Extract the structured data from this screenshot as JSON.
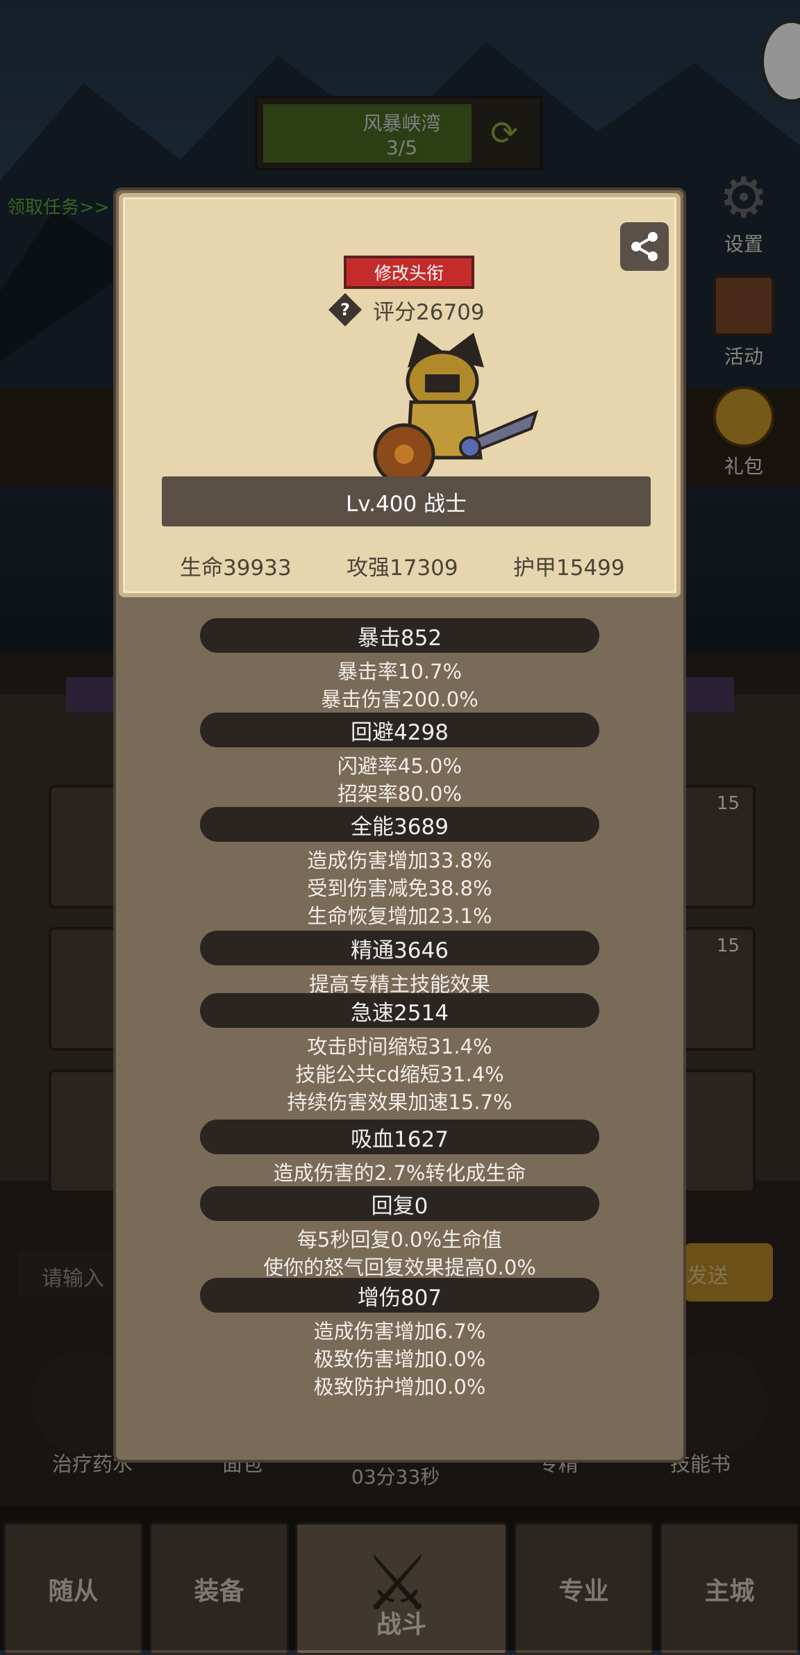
{
  "top_banner": {
    "location": "风暴峡湾",
    "progress": "3/5"
  },
  "quest_link": "领取任务>>",
  "side_menu": [
    {
      "label": "设置",
      "icon": "gear-icon"
    },
    {
      "label": "活动",
      "icon": "calendar-icon"
    },
    {
      "label": "礼包",
      "icon": "gift-icon"
    }
  ],
  "background": {
    "slot_badges": [
      "15",
      "15"
    ],
    "chat_placeholder": "请输入",
    "send_label": "发送",
    "bottom_items": [
      "治疗药水",
      "面包",
      "专精",
      "技能书"
    ],
    "timer": "03分33秒"
  },
  "tabs": [
    {
      "label": "随从",
      "active": false
    },
    {
      "label": "装备",
      "active": false
    },
    {
      "label": "战斗",
      "active": true
    },
    {
      "label": "专业",
      "active": false
    },
    {
      "label": "主城",
      "active": false
    }
  ],
  "profile": {
    "change_title_label": "修改头衔",
    "score": "评分26709",
    "level_class": "Lv.400 战士",
    "hp": "生命39933",
    "attack": "攻强17309",
    "armor": "护甲15499"
  },
  "stat_groups": [
    {
      "header": "暴击852",
      "lines": [
        "暴击率10.7%",
        "暴击伤害200.0%"
      ]
    },
    {
      "header": "回避4298",
      "lines": [
        "闪避率45.0%",
        "招架率80.0%"
      ]
    },
    {
      "header": "全能3689",
      "lines": [
        "造成伤害增加33.8%",
        "受到伤害减免38.8%",
        "生命恢复增加23.1%"
      ]
    },
    {
      "header": "精通3646",
      "lines": [
        "提高专精主技能效果"
      ]
    },
    {
      "header": "急速2514",
      "lines": [
        "攻击时间缩短31.4%",
        "技能公共cd缩短31.4%",
        "持续伤害效果加速15.7%"
      ]
    },
    {
      "header": "吸血1627",
      "lines": [
        "造成伤害的2.7%转化成生命"
      ]
    },
    {
      "header": "回复0",
      "lines": [
        "每5秒回复0.0%生命值",
        "使你的怒气回复效果提高0.0%"
      ]
    },
    {
      "header": "增伤807",
      "lines": [
        "造成伤害增加6.7%",
        "极致伤害增加0.0%",
        "极致防护增加0.0%"
      ]
    }
  ],
  "colors": {
    "card": "#e7d5ae",
    "modal": "#7a6a58",
    "title_button": "#c42c2c",
    "header_pill": "#2a2521"
  }
}
